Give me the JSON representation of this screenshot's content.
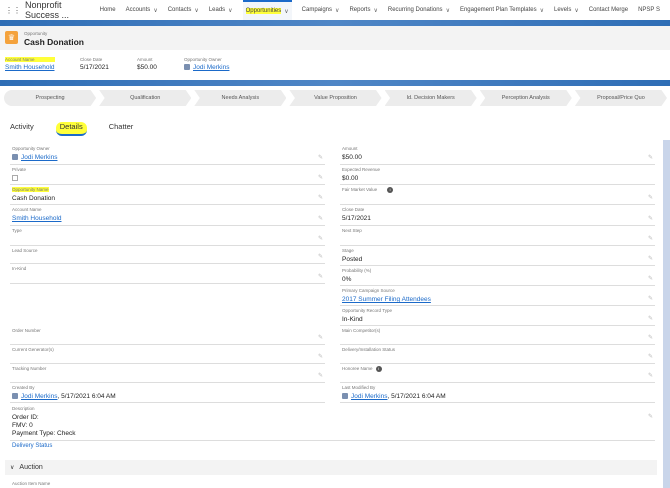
{
  "nav": {
    "app_name": "Nonprofit Success ...",
    "items": [
      {
        "label": "Home",
        "chevron": false
      },
      {
        "label": "Accounts",
        "chevron": true
      },
      {
        "label": "Contacts",
        "chevron": true
      },
      {
        "label": "Leads",
        "chevron": true
      },
      {
        "label": "Opportunities",
        "chevron": true,
        "active": true
      },
      {
        "label": "Campaigns",
        "chevron": true
      },
      {
        "label": "Reports",
        "chevron": true
      },
      {
        "label": "Recurring Donations",
        "chevron": true
      },
      {
        "label": "Engagement Plan Templates",
        "chevron": true
      },
      {
        "label": "Levels",
        "chevron": true
      },
      {
        "label": "Contact Merge",
        "chevron": false
      },
      {
        "label": "NPSP S",
        "chevron": false
      }
    ]
  },
  "header": {
    "object": "Opportunity",
    "title": "Cash Donation",
    "icon": "crown-icon",
    "icon_color": "#f4a23c"
  },
  "highlights": [
    {
      "label": "Account Name",
      "value": "Smith Household",
      "link": true,
      "highlight": true
    },
    {
      "label": "Close Date",
      "value": "5/17/2021"
    },
    {
      "label": "Amount",
      "value": "$50.00"
    },
    {
      "label": "Opportunity Owner",
      "value": "Jodi Merkins",
      "link": true,
      "avatar": true
    }
  ],
  "path": [
    "Prospecting",
    "Qualification",
    "Needs Analysis",
    "Value Proposition",
    "Id. Decision Makers",
    "Perception Analysis",
    "Proposal/Price Quo"
  ],
  "tabs": [
    {
      "label": "Activity"
    },
    {
      "label": "Details",
      "active": true
    },
    {
      "label": "Chatter"
    }
  ],
  "left_fields": [
    {
      "label": "Opportunity Owner",
      "value": "Jodi Merkins",
      "link": true,
      "avatar": true
    },
    {
      "label": "Private",
      "checkbox": true
    },
    {
      "label": "Opportunity Name",
      "value": "Cash Donation",
      "highlight": true
    },
    {
      "label": "Account Name",
      "value": "Smith Household",
      "link": true
    },
    {
      "label": "Type",
      "value": ""
    },
    {
      "label": "Lead Source",
      "value": ""
    },
    {
      "label": "In-Kind",
      "value": ""
    },
    {
      "label": "Order Number",
      "value": ""
    },
    {
      "label": "Current Generator(s)",
      "value": ""
    },
    {
      "label": "Tracking Number",
      "value": ""
    },
    {
      "label": "Created By",
      "value": "Jodi Merkins",
      "link": true,
      "avatar": true,
      "suffix": ", 5/17/2021 6:04 AM",
      "noedit": true
    }
  ],
  "right_fields": [
    {
      "label": "Amount",
      "value": "$50.00"
    },
    {
      "label": "Expected Revenue",
      "value": "$0.00",
      "noedit": true
    },
    {
      "label": "Fair Market Value",
      "value": "",
      "info": true
    },
    {
      "label": "Close Date",
      "value": "5/17/2021"
    },
    {
      "label": "Next Step",
      "value": ""
    },
    {
      "label": "Stage",
      "value": "Posted"
    },
    {
      "label": "Probability (%)",
      "value": "0%"
    },
    {
      "label": "Primary Campaign Source",
      "value": "2017 Summer Filing Attendees",
      "link": true
    },
    {
      "label": "Opportunity Record Type",
      "value": "In-Kind"
    },
    {
      "label": "Main Competitor(s)",
      "value": ""
    },
    {
      "label": "Delivery/Installation Status",
      "value": ""
    },
    {
      "label": "Honoree Name",
      "value": "",
      "info": true
    },
    {
      "label": "Last Modified By",
      "value": "Jodi Merkins",
      "link": true,
      "avatar": true,
      "suffix": ", 5/17/2021 6:04 AM",
      "noedit": true
    }
  ],
  "description": {
    "label": "Description",
    "lines": [
      "Order ID:",
      "FMV: 0",
      "Payment Type: Check"
    ]
  },
  "delivery_status_link": "Delivery Status",
  "auction": {
    "section": "Auction",
    "first_field": "Auction Item Name"
  }
}
